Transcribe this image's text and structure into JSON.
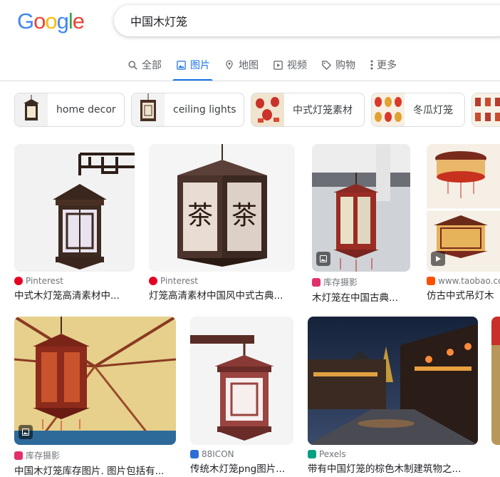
{
  "logo": "Google",
  "search": {
    "query": "中国木灯笼"
  },
  "tabs": [
    {
      "label": "全部",
      "icon": "search-icon"
    },
    {
      "label": "图片",
      "icon": "image-icon",
      "active": true
    },
    {
      "label": "地图",
      "icon": "pin-icon"
    },
    {
      "label": "视频",
      "icon": "play-icon"
    },
    {
      "label": "购物",
      "icon": "tag-icon"
    },
    {
      "label": "更多",
      "icon": "more-vert-icon"
    }
  ],
  "chips": [
    {
      "label": "home decor"
    },
    {
      "label": "ceiling lights"
    },
    {
      "label": "中式灯笼素材"
    },
    {
      "label": "冬瓜灯笼"
    }
  ],
  "results_row1": [
    {
      "source": "Pinterest",
      "title": "中式木灯笼高清素材中..."
    },
    {
      "source": "Pinterest",
      "title": "灯笼高清素材中国风中式古典..."
    },
    {
      "source": "库存摄影",
      "title": "木灯笼在中国古典..."
    },
    {
      "source": "www.taobao.co",
      "title": "仿古中式吊灯木"
    }
  ],
  "results_row2": [
    {
      "source": "库存摄影",
      "title": "中国木灯笼库存图片. 图片包括有..."
    },
    {
      "source": "88ICON",
      "title": "传统木灯笼png图片..."
    },
    {
      "source": "Pexels",
      "title": "带有中国灯笼的棕色木制建筑物之..."
    }
  ],
  "colors": {
    "accent": "#1a73e8",
    "pinterest": "#e60023",
    "taobao": "#ff5000",
    "pexels": "#05a081"
  }
}
